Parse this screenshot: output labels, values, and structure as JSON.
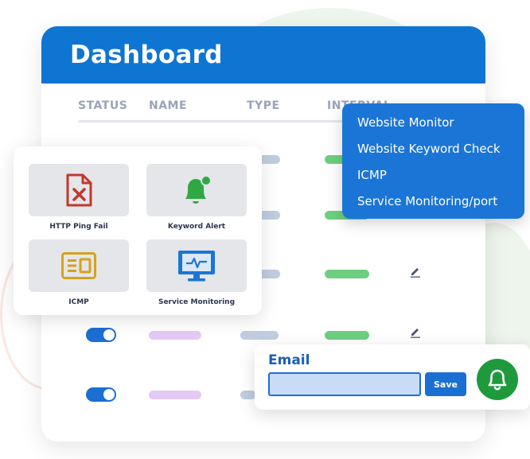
{
  "dashboard": {
    "title": "Dashboard",
    "columns": [
      "STATUS",
      "NAME",
      "TYPE",
      "INTERVAL"
    ]
  },
  "monitor_types": [
    "Website Monitor",
    "Website Keyword Check",
    "ICMP",
    "Service Monitoring/port"
  ],
  "alerts": [
    {
      "label": "HTTP Ping Fail",
      "icon": "file-error-icon"
    },
    {
      "label": "Keyword Alert",
      "icon": "bell-notification-icon"
    },
    {
      "label": "ICMP",
      "icon": "icmp-icon"
    },
    {
      "label": "Service Monitoring",
      "icon": "monitor-icon"
    }
  ],
  "email": {
    "label": "Email",
    "value": "",
    "save_label": "Save"
  },
  "colors": {
    "primary": "#0f75d3",
    "green": "#1e9a3c",
    "error": "#c0392b",
    "yellow": "#d6a21a"
  }
}
